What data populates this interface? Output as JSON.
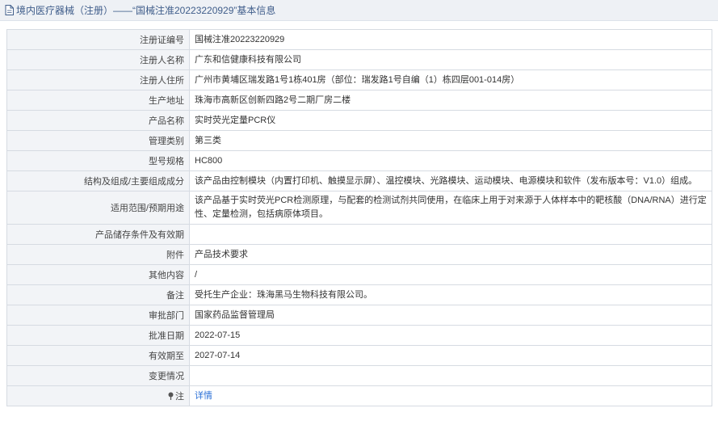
{
  "header": {
    "title": "境内医疗器械（注册）——“国械注准20223220929”基本信息"
  },
  "rows": [
    {
      "label": "注册证编号",
      "value": "国械注准20223220929"
    },
    {
      "label": "注册人名称",
      "value": "广东和信健康科技有限公司"
    },
    {
      "label": "注册人住所",
      "value": "广州市黄埔区瑞发路1号1栋401房（部位：瑞发路1号自编（1）栋四层001-014房）"
    },
    {
      "label": "生产地址",
      "value": "珠海市高新区创新四路2号二期厂房二楼"
    },
    {
      "label": "产品名称",
      "value": "实时荧光定量PCR仪"
    },
    {
      "label": "管理类别",
      "value": "第三类"
    },
    {
      "label": "型号规格",
      "value": "HC800"
    },
    {
      "label": "结构及组成/主要组成成分",
      "value": "该产品由控制模块（内置打印机、触摸显示屏）、温控模块、光路模块、运动模块、电源模块和软件（发布版本号：V1.0）组成。"
    },
    {
      "label": "适用范围/预期用途",
      "value": "该产品基于实时荧光PCR检测原理，与配套的检测试剂共同使用，在临床上用于对来源于人体样本中的靶核酸（DNA/RNA）进行定性、定量检测，包括病原体项目。"
    },
    {
      "label": "产品储存条件及有效期",
      "value": ""
    },
    {
      "label": "附件",
      "value": "产品技术要求"
    },
    {
      "label": "其他内容",
      "value": "/"
    },
    {
      "label": "备注",
      "value": "受托生产企业：珠海黑马生物科技有限公司。"
    },
    {
      "label": "审批部门",
      "value": "国家药品监督管理局"
    },
    {
      "label": "批准日期",
      "value": "2022-07-15"
    },
    {
      "label": "有效期至",
      "value": "2027-07-14"
    },
    {
      "label": "变更情况",
      "value": ""
    }
  ],
  "note_row": {
    "label": "注",
    "link_text": "详情"
  }
}
